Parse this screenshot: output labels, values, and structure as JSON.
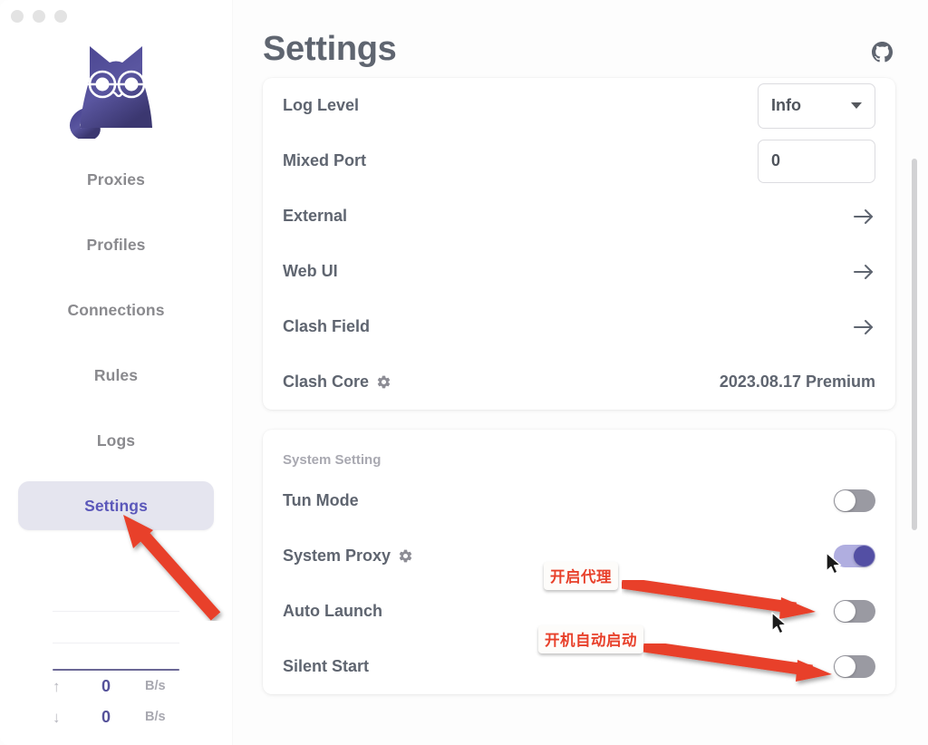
{
  "window": {
    "controls": [
      "close",
      "minimize",
      "maximize"
    ]
  },
  "sidebar": {
    "logo_alt": "clash-verge-cat-logo",
    "items": [
      {
        "label": "Proxies",
        "active": false
      },
      {
        "label": "Profiles",
        "active": false
      },
      {
        "label": "Connections",
        "active": false
      },
      {
        "label": "Rules",
        "active": false
      },
      {
        "label": "Logs",
        "active": false
      },
      {
        "label": "Settings",
        "active": true
      }
    ],
    "traffic": {
      "upload": {
        "arrow": "↑",
        "value": "0",
        "unit": "B/s"
      },
      "download": {
        "arrow": "↓",
        "value": "0",
        "unit": "B/s"
      }
    }
  },
  "header": {
    "title": "Settings",
    "github_icon": "github-icon"
  },
  "clash_setting": {
    "rows": [
      {
        "label": "Log Level",
        "control": "select",
        "value": "Info"
      },
      {
        "label": "Mixed Port",
        "control": "input",
        "value": "0"
      },
      {
        "label": "External",
        "control": "chevron",
        "value": ""
      },
      {
        "label": "Web UI",
        "control": "chevron",
        "value": ""
      },
      {
        "label": "Clash Field",
        "control": "chevron",
        "value": ""
      },
      {
        "label": "Clash Core",
        "control": "text",
        "value": "2023.08.17 Premium",
        "gear": true
      }
    ]
  },
  "system_setting": {
    "section_label": "System Setting",
    "rows": [
      {
        "label": "Tun Mode",
        "control": "toggle",
        "on": false,
        "gear": false
      },
      {
        "label": "System Proxy",
        "control": "toggle",
        "on": true,
        "gear": true
      },
      {
        "label": "Auto Launch",
        "control": "toggle",
        "on": false,
        "gear": false
      },
      {
        "label": "Silent Start",
        "control": "toggle",
        "on": false,
        "gear": false
      }
    ]
  },
  "annotations": {
    "enable_proxy_label": "开启代理",
    "auto_start_label": "开机自动启动",
    "arrow_color": "#e8402a"
  },
  "colors": {
    "accent": "#5b58ba",
    "toggle_on_track": "#b0aee0",
    "toggle_on_knob": "#534fa4",
    "toggle_off_track": "#9a9aa2",
    "text_primary": "#5f6570",
    "text_muted": "#a9a9b1",
    "annotation_red": "#e8402a"
  }
}
